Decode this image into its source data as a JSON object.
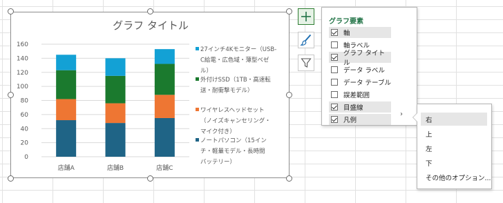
{
  "chart_data": {
    "type": "bar",
    "stacked": true,
    "title": "グラフ タイトル",
    "categories": [
      "店舗A",
      "店舗B",
      "店舗C"
    ],
    "series": [
      {
        "name": "ノートパソコン（15インチ・軽量モデル・長時間バッテリー）",
        "color": "#1f6486",
        "values": [
          52,
          48,
          55
        ]
      },
      {
        "name": "ワイヤレスヘッドセット（ノイズキャンセリング・マイク付き）",
        "color": "#ee7633",
        "values": [
          30,
          28,
          33
        ]
      },
      {
        "name": "外付けSSD（1TB・高速転送・耐衝撃モデル）",
        "color": "#1b7a2e",
        "values": [
          41,
          39,
          44
        ]
      },
      {
        "name": "27インチ4Kモニター（USB-C給電・広色域・薄型ベゼル）",
        "color": "#13a1d5",
        "values": [
          22,
          25,
          21
        ]
      }
    ],
    "yticks": [
      "0",
      "20",
      "40",
      "60",
      "80",
      "100",
      "120",
      "140",
      "160"
    ],
    "ylim": [
      0,
      160
    ],
    "grid": true,
    "legend_position": "right"
  },
  "legend_lines": [
    [
      "27インチ4Kモニター（USB-",
      "C給電・広色域・薄型ベゼ",
      "ル）"
    ],
    [
      "外付けSSD（1TB・高速転",
      "送・耐衝撃モデル）"
    ],
    [
      "ワイヤレスヘッドセット",
      "（ノイズキャンセリング・",
      "マイク付き）"
    ],
    [
      "ノートパソコン（15イン",
      "チ・軽量モデル・長時間",
      "バッテリー）"
    ]
  ],
  "side_buttons": {
    "elements_icon": "plus-icon",
    "styles_icon": "paintbrush-icon",
    "filters_icon": "funnel-icon"
  },
  "elements_pane": {
    "title": "グラフ要素",
    "items": [
      {
        "label": "軸",
        "checked": true
      },
      {
        "label": "軸ラベル",
        "checked": false
      },
      {
        "label": "グラフ タイトル",
        "checked": true
      },
      {
        "label": "データ ラベル",
        "checked": false
      },
      {
        "label": "データ テーブル",
        "checked": false
      },
      {
        "label": "誤差範囲",
        "checked": false
      },
      {
        "label": "目盛線",
        "checked": true
      },
      {
        "label": "凡例",
        "checked": true
      }
    ],
    "legend_arrow": "›"
  },
  "legend_submenu": {
    "items": [
      "右",
      "上",
      "左",
      "下",
      "その他のオプション..."
    ]
  },
  "colors": {
    "accent_green": "#217346",
    "grid_line": "#d9d9d9"
  }
}
